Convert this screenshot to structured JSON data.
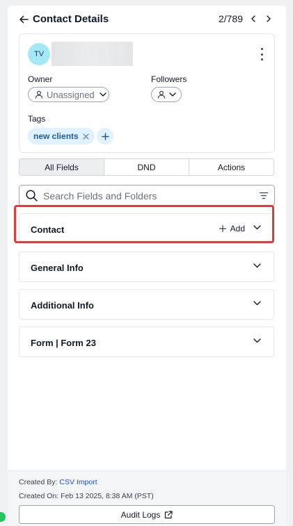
{
  "header": {
    "title": "Contact Details",
    "pager": "2/789"
  },
  "contact": {
    "initials": "TV",
    "owner_label": "Owner",
    "owner_value": "Unassigned",
    "followers_label": "Followers",
    "tags_label": "Tags",
    "tags": [
      "new clients"
    ]
  },
  "tabs": [
    {
      "label": "All Fields",
      "active": true
    },
    {
      "label": "DND",
      "active": false
    },
    {
      "label": "Actions",
      "active": false
    }
  ],
  "search": {
    "placeholder": "Search Fields and Folders"
  },
  "sections": [
    {
      "title": "Contact",
      "action": "Add"
    },
    {
      "title": "General Info"
    },
    {
      "title": "Additional Info"
    },
    {
      "title": "Form | Form 23"
    }
  ],
  "footer": {
    "created_by_label": "Created By:",
    "created_by_value": "CSV Import",
    "created_on_label": "Created On:",
    "created_on_value": "Feb 13 2025, 8:38 AM (PST)",
    "audit_logs_label": "Audit Logs"
  },
  "colors": {
    "highlight": "#e23a3a",
    "avatar": "#a5e8f7",
    "tag": "#e0f2fe",
    "link": "#1d4ed8"
  },
  "icons": [
    "arrow-left-icon",
    "chevron-left-icon",
    "chevron-right-icon",
    "kebab-menu-icon",
    "user-icon",
    "chevron-down-icon",
    "close-icon",
    "plus-icon",
    "search-icon",
    "filter-icon",
    "external-link-icon"
  ]
}
